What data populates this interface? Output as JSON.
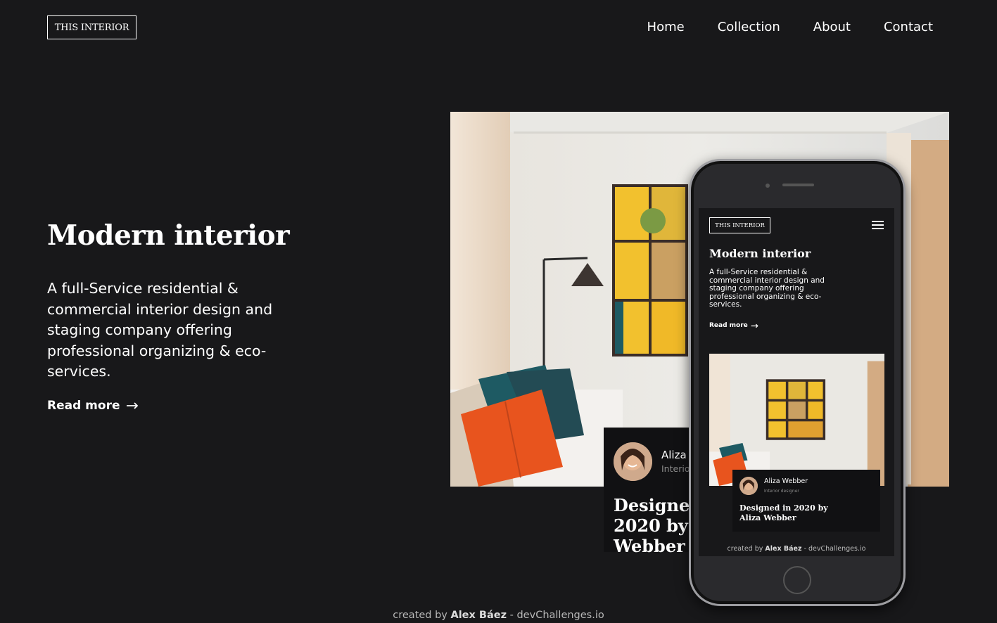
{
  "header": {
    "logo": "THIS INTERIOR",
    "nav": [
      "Home",
      "Collection",
      "About",
      "Contact"
    ]
  },
  "hero": {
    "title": "Modern interior",
    "description": "A full-Service residential & commercial interior design and staging company offering professional organizing & eco-services.",
    "read_more": "Read more"
  },
  "card": {
    "name": "Aliza Webber",
    "role": "Interior designer",
    "title": "Designed in 2020 by Aliza Webber"
  },
  "credit": {
    "prefix": "created by",
    "author": "Alex Báez",
    "suffix": "- devChallenges.io"
  },
  "colors": {
    "background": "#18181a",
    "card": "#111113",
    "accent_yellow": "#f2c12e",
    "pillow_orange": "#e8541e",
    "pillow_teal": "#1e5a63"
  },
  "icons": [
    "arrow-right-icon",
    "hamburger-menu-icon"
  ]
}
